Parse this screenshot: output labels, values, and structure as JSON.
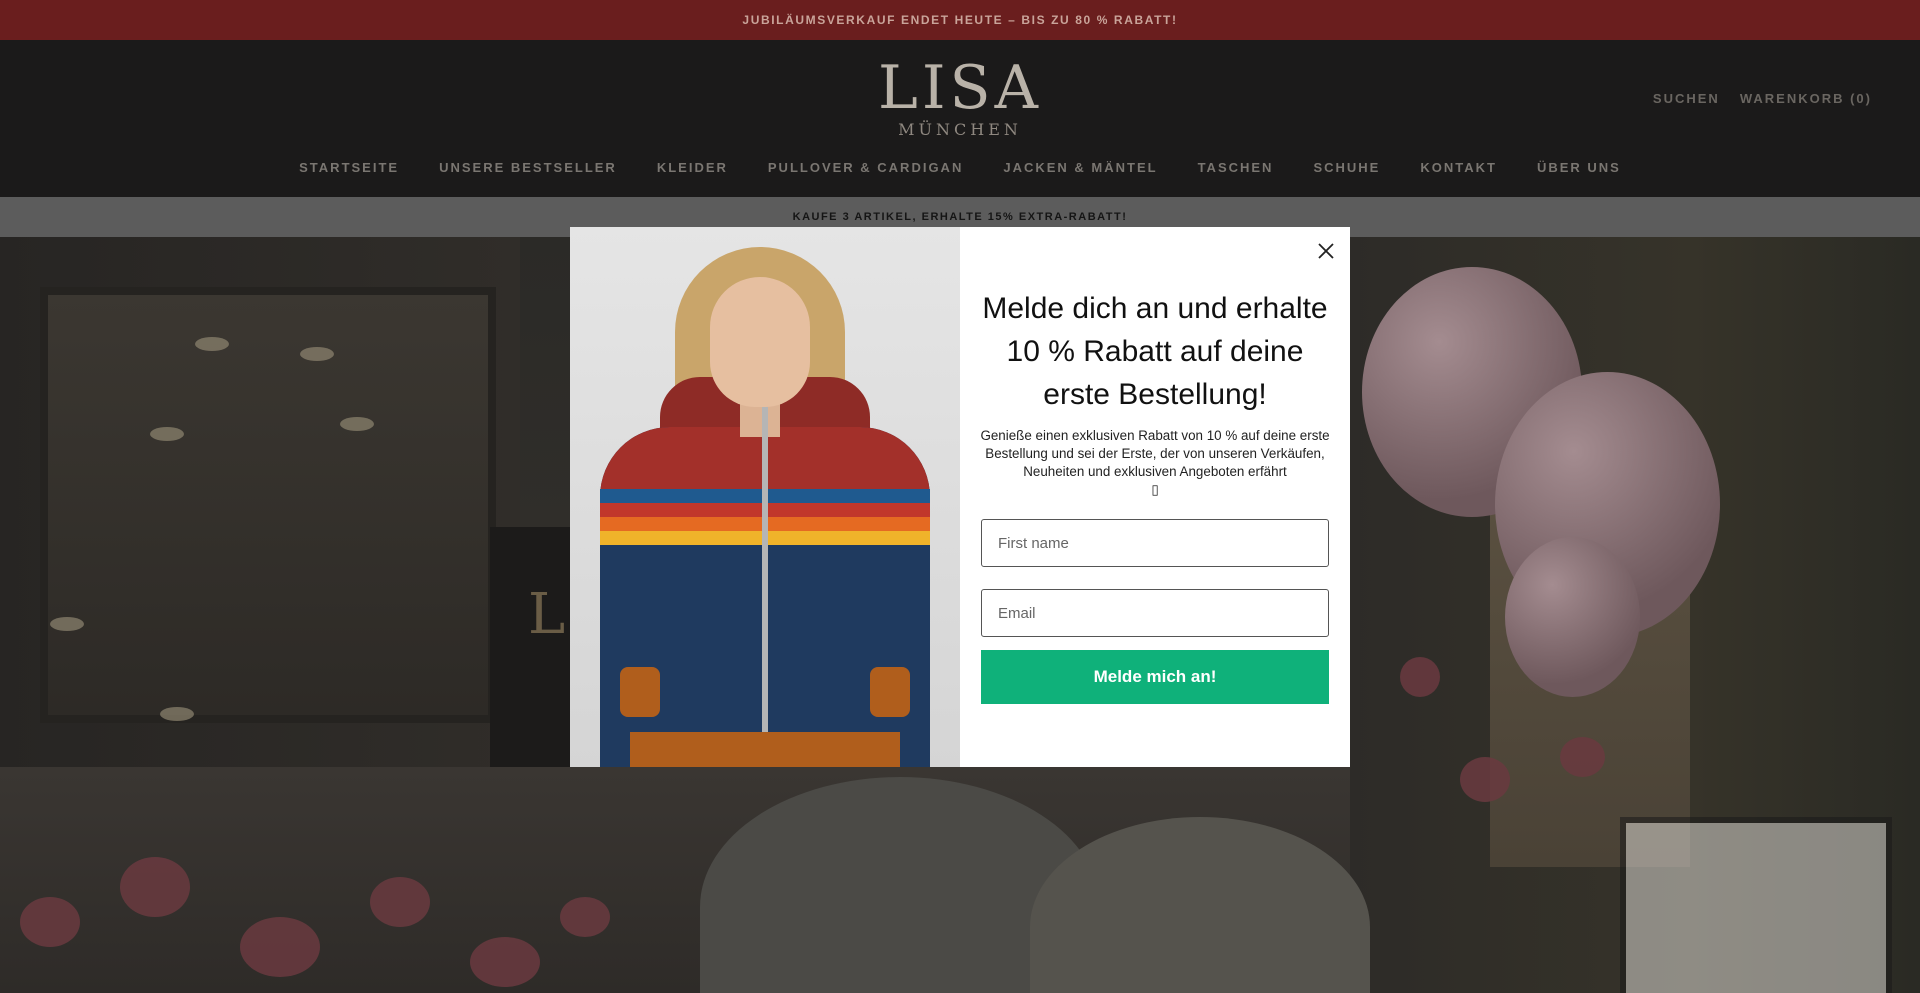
{
  "announcement": "JUBILÄUMSVERKAUF ENDET HEUTE – BIS ZU 80 % RABATT!",
  "logo": {
    "main": "LISA",
    "sub": "MÜNCHEN"
  },
  "header_actions": {
    "search": "SUCHEN",
    "cart": "WARENKORB (0)"
  },
  "nav": [
    "STARTSEITE",
    "UNSERE BESTSELLER",
    "KLEIDER",
    "PULLOVER & CARDIGAN",
    "JACKEN & MÄNTEL",
    "TASCHEN",
    "SCHUHE",
    "KONTAKT",
    "ÜBER UNS"
  ],
  "promo_bar": "KAUFE 3 ARTIKEL, ERHALTE 15% EXTRA-RABATT!",
  "hero": {
    "sign_letter": "L"
  },
  "popup": {
    "title": "Melde dich an und erhalte 10 % Rabatt auf deine erste Bestellung!",
    "text": "Genieße einen exklusiven Rabatt von 10 % auf deine erste Bestellung und sei der Erste, der von unseren Verkäufen, Neuheiten und exklusiven Angeboten erfährt",
    "text_glyph": "▯",
    "first_name_placeholder": "First name",
    "email_placeholder": "Email",
    "submit_label": "Melde mich an!"
  },
  "colors": {
    "announcement_bg": "#6a1e1e",
    "header_bg": "#1b1a1a",
    "submit_bg": "#0fb17a"
  }
}
